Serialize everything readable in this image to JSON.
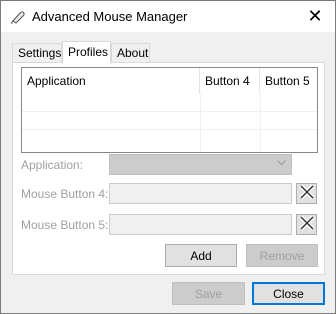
{
  "window": {
    "title": "Advanced Mouse Manager",
    "close_glyph": "✕"
  },
  "tabs": [
    {
      "label": "Settings",
      "active": false
    },
    {
      "label": "Profiles",
      "active": true
    },
    {
      "label": "About",
      "active": false
    }
  ],
  "list": {
    "columns": [
      "Application",
      "Button 4",
      "Button 5"
    ],
    "rows": []
  },
  "form": {
    "application_label": "Application:",
    "application_value": "",
    "button4_label": "Mouse Button 4:",
    "button4_value": "",
    "button5_label": "Mouse Button 5:",
    "button5_value": ""
  },
  "buttons": {
    "add": "Add",
    "remove": "Remove",
    "save": "Save",
    "close": "Close"
  },
  "icons": {
    "app": "mouse-icon",
    "clear": "clear-x-icon",
    "dropdown": "chevron-down-icon"
  },
  "colors": {
    "accent": "#0078d7",
    "disabled_text": "#a0a0a0",
    "window_bg": "#f0f0f0"
  }
}
